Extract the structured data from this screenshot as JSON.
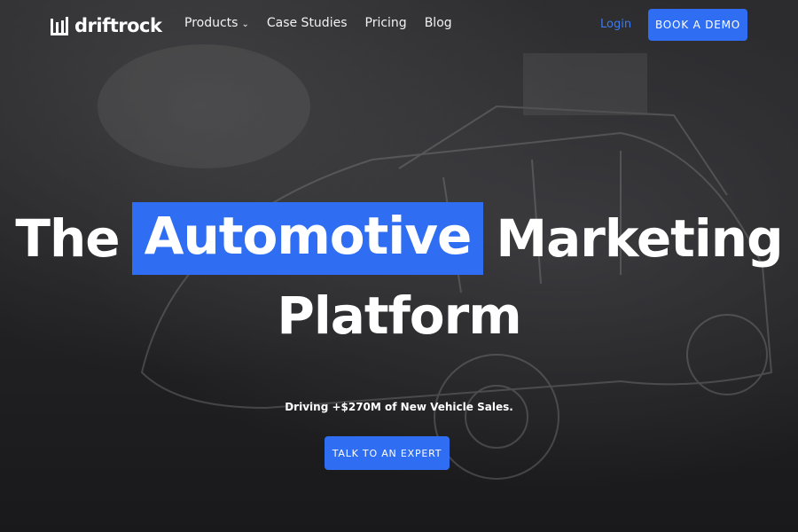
{
  "brand": {
    "name": "driftrock"
  },
  "nav": {
    "items": [
      {
        "label": "Products",
        "has_dropdown": true
      },
      {
        "label": "Case Studies"
      },
      {
        "label": "Pricing"
      },
      {
        "label": "Blog"
      }
    ],
    "login_label": "Login",
    "demo_label": "BOOK A DEMO"
  },
  "hero": {
    "headline_pre": "The",
    "headline_highlight": "Automotive",
    "headline_post": "Marketing",
    "headline_line2": "Platform",
    "subheadline": "Driving +$270M of New Vehicle Sales.",
    "cta_label": "TALK TO AN EXPERT"
  },
  "colors": {
    "accent": "#2f6ef2",
    "login_link": "#3b7bf0",
    "background": "#2a2a2c"
  },
  "icons": {
    "logo": "bar-chart-logo-icon",
    "dropdown": "chevron-down-icon"
  }
}
